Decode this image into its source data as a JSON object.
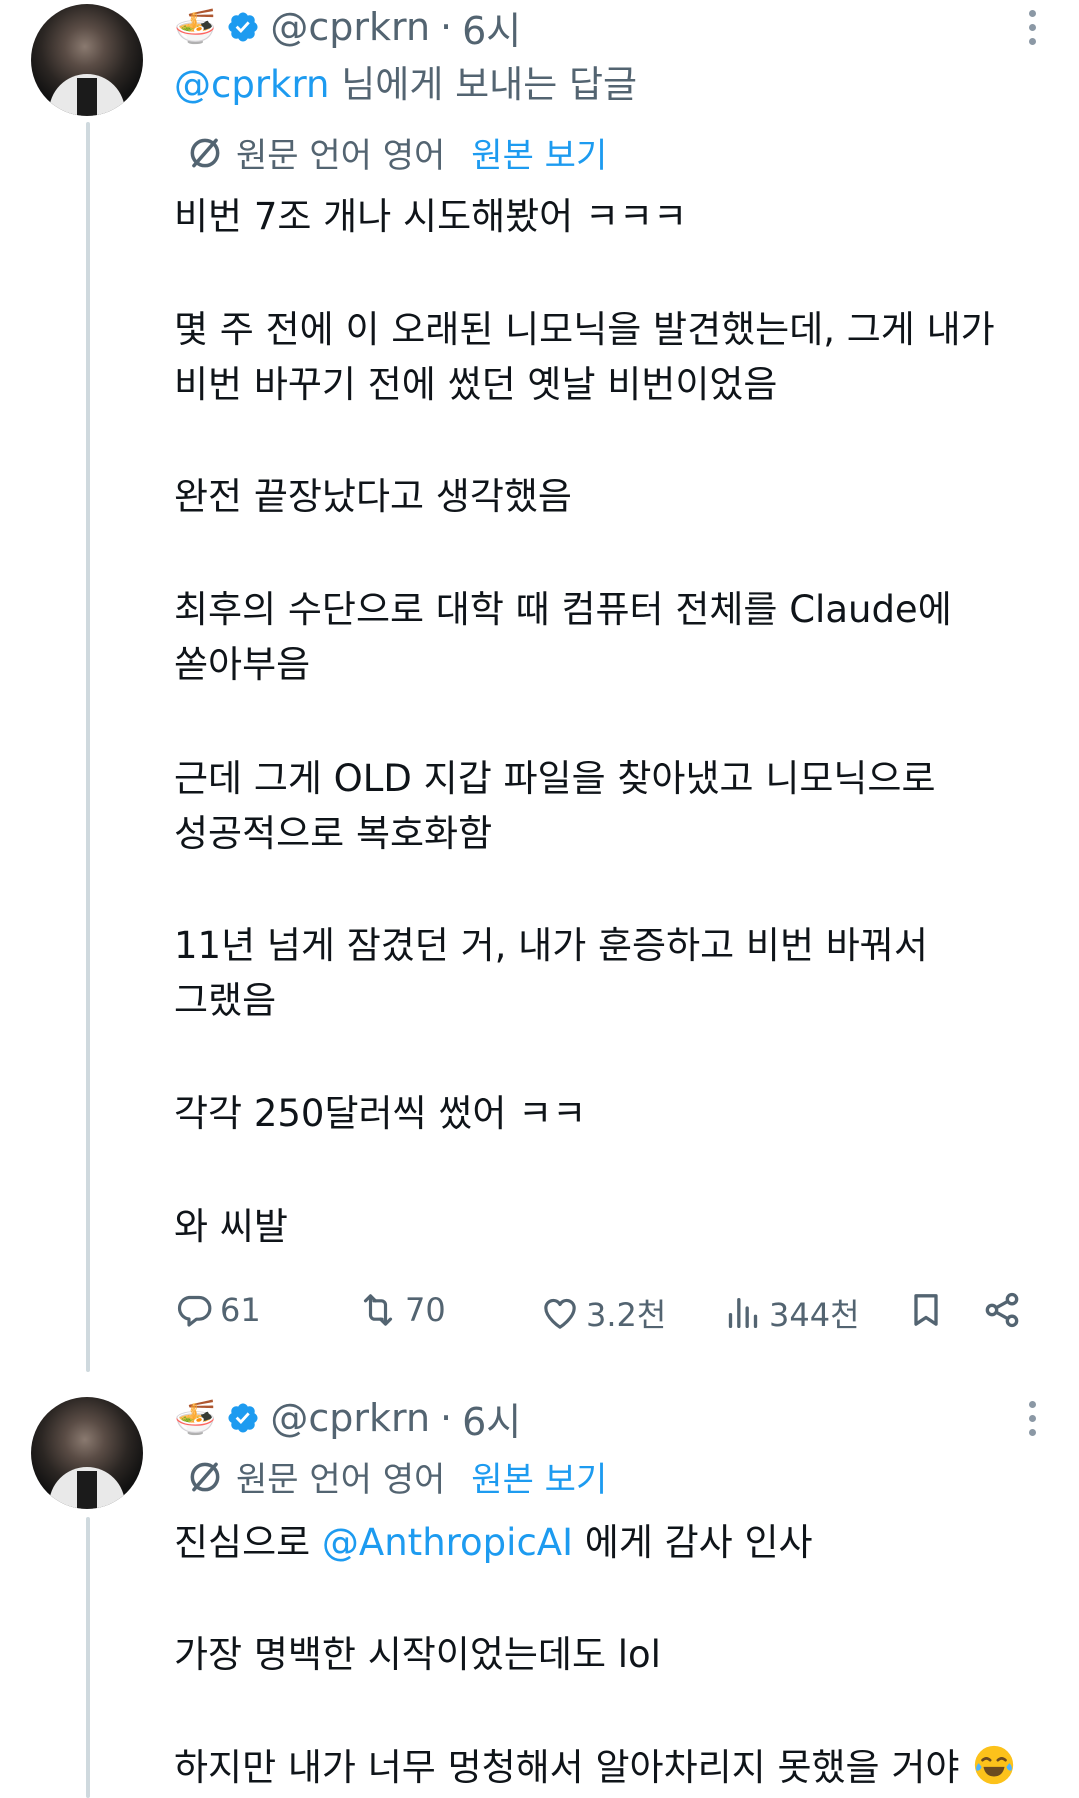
{
  "tweets": [
    {
      "emoji": "🍜",
      "handle": "@cprkrn",
      "dot": "·",
      "time": "6시",
      "reply_to": {
        "mention": "@cprkrn",
        "suffix": " 님에게 보내는 답글"
      },
      "translate": {
        "label": "원문 언어 영어",
        "show": "원본 보기"
      },
      "lines": [
        "비번 7조 개나 시도해봤어 ㅋㅋㅋ",
        "몇 주 전에 이 오래된 니모닉을 발견했는데, 그게 내가",
        "비번 바꾸기 전에 썼던 옛날 비번이었음",
        "완전 끝장났다고 생각했음",
        "최후의 수단으로 대학 때 컴퓨터 전체를 Claude에",
        "쏟아부음",
        "근데 그게 OLD 지갑 파일을 찾아냈고 니모닉으로",
        "성공적으로 복호화함",
        "11년 넘게 잠겼던 거, 내가 훈증하고 비번 바꿔서",
        "그랬음",
        "각각 250달러씩 썼어 ㅋㅋ",
        "와 씨발"
      ],
      "actions": {
        "replies": "61",
        "retweets": "70",
        "likes": "3.2천",
        "views": "344천"
      }
    },
    {
      "emoji": "🍜",
      "handle": "@cprkrn",
      "dot": "·",
      "time": "6시",
      "translate": {
        "label": "원문 언어 영어",
        "show": "원본 보기"
      },
      "line1_prefix": "진심으로 ",
      "line1_mention": "@AnthropicAI",
      "line1_suffix": " 에게 감사 인사",
      "line2": "가장 명백한 시작이었는데도 lol",
      "line3": "하지만 내가 너무 멍청해서 알아차리지 못했을 거야"
    }
  ],
  "colors": {
    "accent": "#1d9bf0",
    "secondary": "#536471",
    "text": "#0f1419",
    "thread": "#cfd9de"
  }
}
